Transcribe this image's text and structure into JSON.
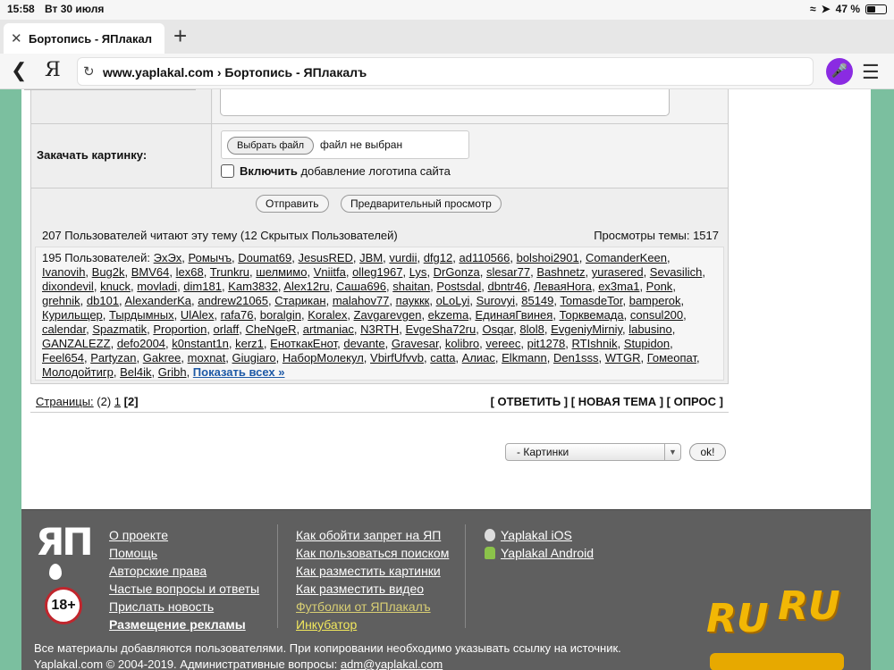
{
  "statusbar": {
    "time": "15:58",
    "date": "Вт 30 июля",
    "battery": "47 %"
  },
  "tab": {
    "title": "Бортопись - ЯПлакал",
    "new_tab": "+"
  },
  "addressbar": {
    "yandex": "Я",
    "url": "www.yaplakal.com › Бортопись - ЯПлакалъ"
  },
  "form": {
    "upload_label": "Закачать картинку:",
    "file_button": "Выбрать файл",
    "file_status": "файл не выбран",
    "logo_bold": "Включить",
    "logo_rest": " добавление логотипа сайта",
    "send": "Отправить",
    "preview": "Предварительный просмотр"
  },
  "stats": {
    "readers": "207 Пользователей читают эту тему (12 Скрытых Пользователей)",
    "views": "Просмотры темы: 1517",
    "users_prefix": "195 Пользователей: ",
    "users": [
      "ЭхЭх",
      "Ромычъ",
      "Doumat69",
      "JesusRED",
      "JBM",
      "vurdii",
      "dfg12",
      "ad110566",
      "bolshoi2901",
      "ComanderKeen",
      "Ivanovih",
      "Bug2k",
      "BMV64",
      "lex68",
      "Trunkru",
      "шелмимо",
      "Vniitfa",
      "olleg1967",
      "Lys",
      "DrGonza",
      "slesar77",
      "Bashnetz",
      "yurasered",
      "Sevasilich",
      "dixondevil",
      "knuck",
      "movladi",
      "dim181",
      "Kam3832",
      "Alex12ru",
      "Саша696",
      "shaitan",
      "Postsdal",
      "dbntr46",
      "ЛеваяНога",
      "ex3ma1",
      "Ponk",
      "grehnik",
      "db101",
      "AlexanderKa",
      "andrew21065",
      "Старикан",
      "malahov77",
      "пауккк",
      "oLoLyi",
      "Surovyi",
      "85149",
      "TomasdeTor",
      "bamperok",
      "Курильщер",
      "Тырдымных",
      "UlAlex",
      "rafa76",
      "boralgin",
      "Koralex",
      "Zavgarevgen",
      "ekzema",
      "ЕдинаяГвинея",
      "Торквемада",
      "consul200",
      "calendar",
      "Spazmatik",
      "Proportion",
      "orlaff",
      "CheNgeR",
      "artmaniac",
      "N3RTH",
      "EvgeSha72ru",
      "Osqar",
      "8lol8",
      "EvgeniyMirniy",
      "labusino",
      "GANZALEZZ",
      "defo2004",
      "k0nstant1n",
      "kerz1",
      "ЕноткакЕнот",
      "devante",
      "Gravesar",
      "kolibro",
      "vereec",
      "pit1278",
      "RTIshnik",
      "Stupidon",
      "Feel654",
      "Partyzan",
      "Gakree",
      "moxnat",
      "Giugiaro",
      "НаборМолекул",
      "VbirfUfvvb",
      "catta",
      "Алиас",
      "Elkmann",
      "Den1sss",
      "WTGR",
      "Гомеопат",
      "Молодойтигр",
      "Bel4ik",
      "Gribh"
    ],
    "show_all": "Показать всех »"
  },
  "pagination": {
    "label": "Страницы:",
    "count": "(2)",
    "page1": "1",
    "page2": "[2]"
  },
  "actions": "[ ОТВЕТИТЬ ] [ НОВАЯ ТЕМА ] [ ОПРОС ]",
  "jump": {
    "selected": "- Картинки",
    "ok": "ok!"
  },
  "footer": {
    "logo": "ЯП",
    "age": "18+",
    "col1": [
      "О проекте",
      "Помощь",
      "Авторские права",
      "Частые вопросы и ответы",
      "Прислать новость",
      "Размещение рекламы"
    ],
    "col2": [
      "Как обойти запрет на ЯП",
      "Как пользоваться поиском",
      "Как разместить картинки",
      "Как разместить видео",
      "Футболки от ЯПлакалъ",
      "Инкубатор"
    ],
    "apps": [
      "Yaplakal iOS",
      "Yaplakal Android"
    ],
    "ruru": "RU",
    "legal1": "Все материалы добавляются пользователями. При копировании необходимо указывать ссылку на источник.",
    "legal2": "Yaplakal.com © 2004-2019. Административные вопросы: ",
    "email": "adm@yaplakal.com"
  }
}
